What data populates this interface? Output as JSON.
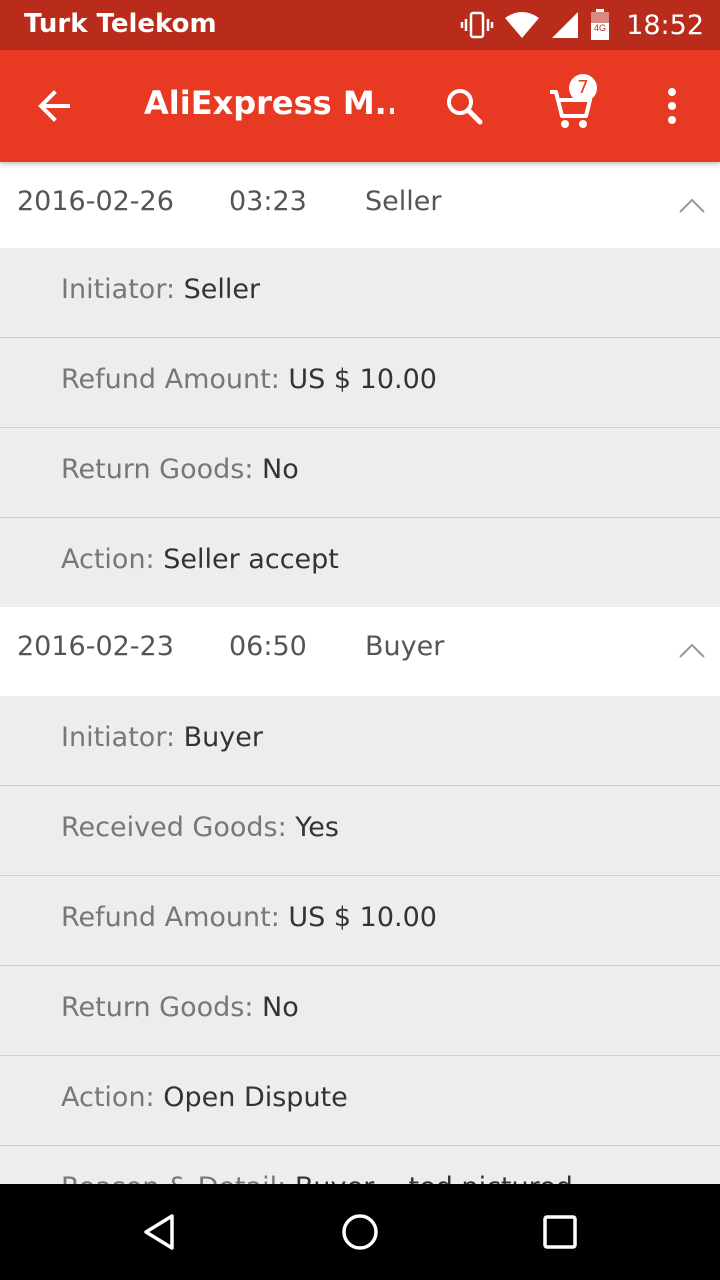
{
  "status_bar": {
    "carrier": "Turk Telekom",
    "time": "18:52",
    "network_type": "4G",
    "icons": [
      "vibrate-icon",
      "wifi-icon",
      "signal-icon",
      "battery-icon"
    ]
  },
  "app_bar": {
    "title": "AliExpress M...",
    "cart_count": "7",
    "color": "#e83a23",
    "icons": [
      "back-arrow-icon",
      "search-icon",
      "cart-icon",
      "more-vert-icon"
    ]
  },
  "history": [
    {
      "date": "2016-02-26",
      "time": "03:23",
      "role": "Seller",
      "details": [
        {
          "label": "Initiator:",
          "value": "Seller"
        },
        {
          "label": "Refund Amount:",
          "value": "US $ 10.00"
        },
        {
          "label": "Return Goods:",
          "value": "No"
        },
        {
          "label": "Action:",
          "value": "Seller accept"
        }
      ]
    },
    {
      "date": "2016-02-23",
      "time": "06:50",
      "role": "Buyer",
      "details": [
        {
          "label": "Initiator:",
          "value": "Buyer"
        },
        {
          "label": "Received Goods:",
          "value": "Yes"
        },
        {
          "label": "Refund Amount:",
          "value": "US $ 10.00"
        },
        {
          "label": "Return Goods:",
          "value": "No"
        },
        {
          "label": "Action:",
          "value": "Open Dispute"
        },
        {
          "label": "Reason & Detail:",
          "value": "Buyer ...ted pictured..."
        }
      ]
    }
  ],
  "nav_bar": {
    "icons": [
      "back-triangle-icon",
      "home-circle-icon",
      "recents-square-icon"
    ]
  }
}
